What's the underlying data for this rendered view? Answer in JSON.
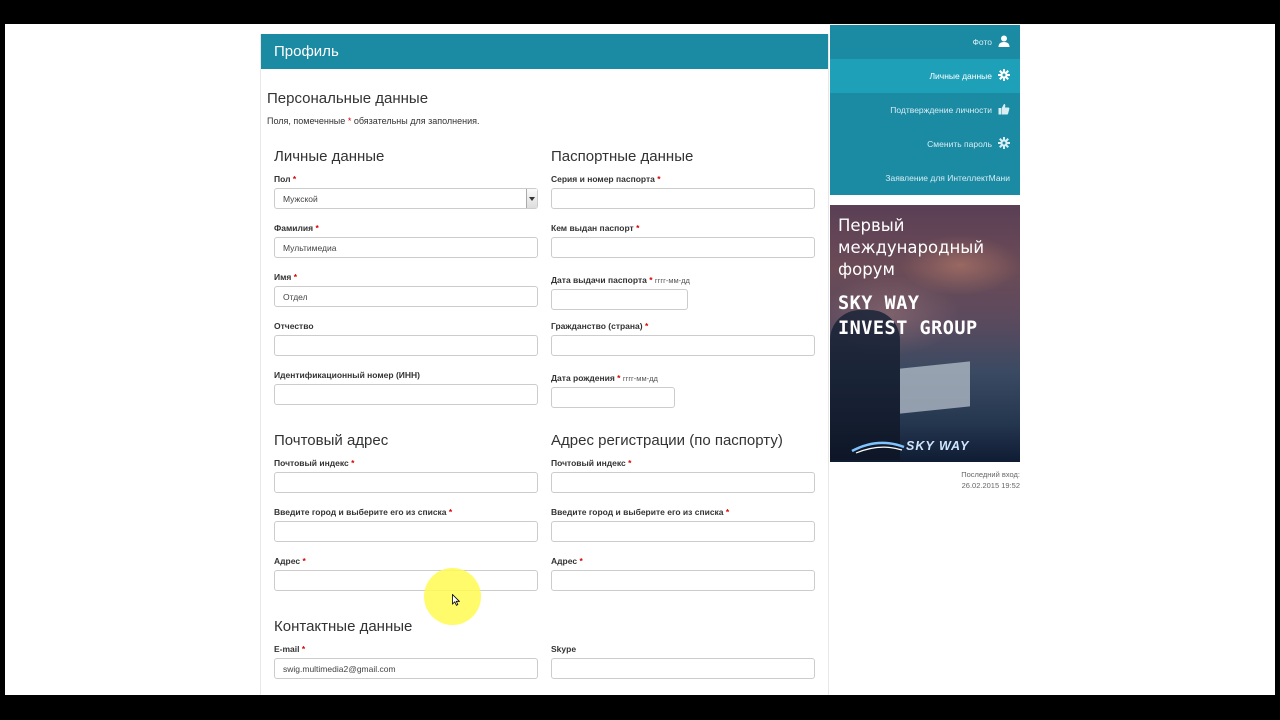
{
  "panel": {
    "title": "Профиль"
  },
  "personal": {
    "title": "Персональные данные",
    "note_before": "Поля, помеченные",
    "note_star": "*",
    "note_after": "обязательны для заполнения."
  },
  "personal_data": {
    "title": "Личные данные",
    "gender_label": "Пол",
    "gender_value": "Мужской",
    "surname_label": "Фамилия",
    "surname_value": "Мультимедиа",
    "name_label": "Имя",
    "name_value": "Отдел",
    "patronymic_label": "Отчество",
    "patronymic_value": "",
    "inn_label": "Идентификационный номер (ИНН)",
    "inn_value": ""
  },
  "passport": {
    "title": "Паспортные данные",
    "series_label": "Серия и номер паспорта",
    "issued_by_label": "Кем выдан паспорт",
    "issue_date_label": "Дата выдачи паспорта",
    "issue_date_hint": "гггг-мм-дд",
    "citizenship_label": "Гражданство (страна)",
    "birth_date_label": "Дата рождения",
    "birth_date_hint": "гггг-мм-дд"
  },
  "postal": {
    "title": "Почтовый адрес",
    "index_label": "Почтовый индекс",
    "city_label": "Введите город и выберите его из списка",
    "address_label": "Адрес"
  },
  "registration": {
    "title": "Адрес регистрации (по паспорту)",
    "index_label": "Почтовый индекс",
    "city_label": "Введите город и выберите его из списка",
    "address_label": "Адрес"
  },
  "contacts": {
    "title": "Контактные данные",
    "email_label": "E-mail",
    "email_value": "swig.multimedia2@gmail.com",
    "skype_label": "Skype",
    "skype_value": ""
  },
  "required_star": "*",
  "sidebar": {
    "items": [
      {
        "label": "Фото",
        "icon": "user-icon",
        "active": false
      },
      {
        "label": "Личные данные",
        "icon": "gear-icon",
        "active": true
      },
      {
        "label": "Подтверждение личности",
        "icon": "thumbs-up-icon",
        "active": false
      },
      {
        "label": "Сменить пароль",
        "icon": "gear-icon",
        "active": false
      },
      {
        "label": "Заявление для ИнтеллектМани",
        "icon": "",
        "active": false
      }
    ]
  },
  "banner": {
    "line1": "Первый",
    "line2": "международный",
    "line3": "форум",
    "line4": "SKY WAY",
    "line5": "INVEST GROUP",
    "logo": "SKY WAY"
  },
  "last_login": {
    "label": "Последний вход:",
    "value": "26.02.2015 19:52"
  },
  "colors": {
    "accent": "#1b8aa3",
    "accent_active": "#1fa0b9",
    "required": "#dd0000",
    "highlight": "#fffa50"
  }
}
